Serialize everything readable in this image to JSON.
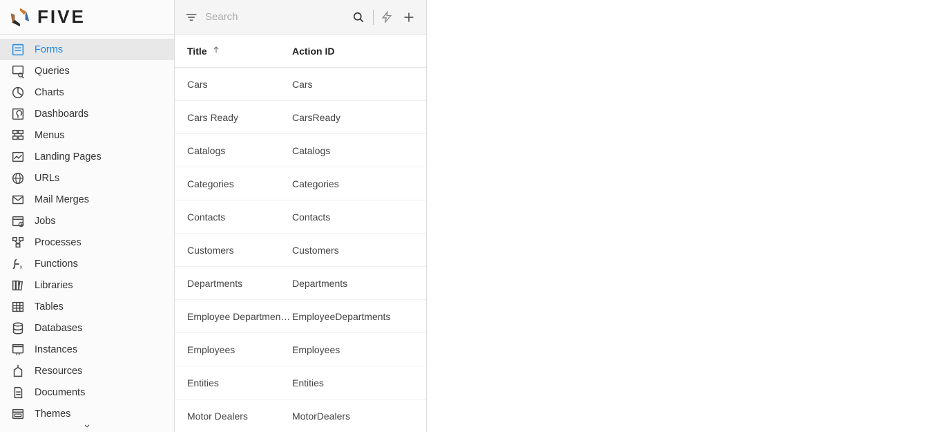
{
  "brand": {
    "name": "FIVE"
  },
  "sidebar": {
    "items": [
      {
        "label": "Forms",
        "icon": "form-icon",
        "active": true
      },
      {
        "label": "Queries",
        "icon": "query-icon"
      },
      {
        "label": "Charts",
        "icon": "chart-icon"
      },
      {
        "label": "Dashboards",
        "icon": "dashboard-icon"
      },
      {
        "label": "Menus",
        "icon": "menu-icon"
      },
      {
        "label": "Landing Pages",
        "icon": "landing-icon"
      },
      {
        "label": "URLs",
        "icon": "url-icon"
      },
      {
        "label": "Mail Merges",
        "icon": "mail-icon"
      },
      {
        "label": "Jobs",
        "icon": "jobs-icon"
      },
      {
        "label": "Processes",
        "icon": "process-icon"
      },
      {
        "label": "Functions",
        "icon": "function-icon"
      },
      {
        "label": "Libraries",
        "icon": "library-icon"
      },
      {
        "label": "Tables",
        "icon": "table-icon"
      },
      {
        "label": "Databases",
        "icon": "database-icon"
      },
      {
        "label": "Instances",
        "icon": "instance-icon"
      },
      {
        "label": "Resources",
        "icon": "resource-icon"
      },
      {
        "label": "Documents",
        "icon": "document-icon"
      },
      {
        "label": "Themes",
        "icon": "theme-icon"
      }
    ]
  },
  "toolbar": {
    "search_placeholder": "Search"
  },
  "table": {
    "headers": {
      "title": "Title",
      "action_id": "Action ID"
    },
    "rows": [
      {
        "title": "Cars",
        "action_id": "Cars"
      },
      {
        "title": "Cars Ready",
        "action_id": "CarsReady"
      },
      {
        "title": "Catalogs",
        "action_id": "Catalogs"
      },
      {
        "title": "Categories",
        "action_id": "Categories"
      },
      {
        "title": "Contacts",
        "action_id": "Contacts"
      },
      {
        "title": "Customers",
        "action_id": "Customers"
      },
      {
        "title": "Departments",
        "action_id": "Departments"
      },
      {
        "title": "Employee Departmen…",
        "action_id": "EmployeeDepartments"
      },
      {
        "title": "Employees",
        "action_id": "Employees"
      },
      {
        "title": "Entities",
        "action_id": "Entities"
      },
      {
        "title": "Motor Dealers",
        "action_id": "MotorDealers"
      }
    ]
  }
}
